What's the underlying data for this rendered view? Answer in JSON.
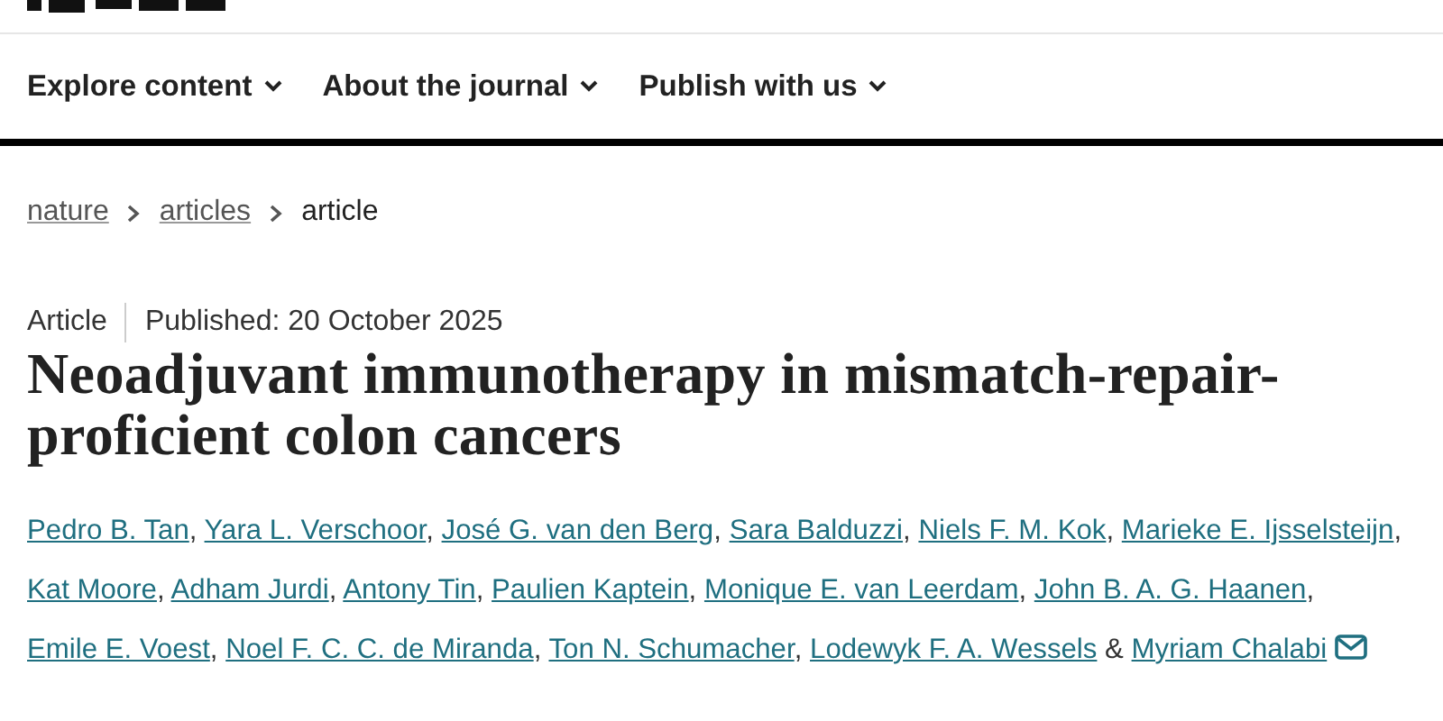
{
  "nav": [
    {
      "label": "Explore content"
    },
    {
      "label": "About the journal"
    },
    {
      "label": "Publish with us"
    }
  ],
  "breadcrumb": [
    {
      "label": "nature",
      "link": true
    },
    {
      "label": "articles",
      "link": true
    },
    {
      "label": "article",
      "link": false
    }
  ],
  "article": {
    "type": "Article",
    "published": "Published: 20 October 2025",
    "title": "Neoadjuvant immunotherapy in mismatch-repair-proficient colon cancers",
    "authors": [
      {
        "name": "Pedro B. Tan",
        "separator": ","
      },
      {
        "name": "Yara L. Verschoor",
        "separator": ","
      },
      {
        "name": "José G. van den Berg",
        "separator": ","
      },
      {
        "name": "Sara Balduzzi",
        "separator": ","
      },
      {
        "name": "Niels F. M. Kok",
        "separator": ","
      },
      {
        "name": "Marieke E. Ijsselsteijn",
        "separator": ","
      },
      {
        "name": "Kat Moore",
        "separator": ","
      },
      {
        "name": "Adham Jurdi",
        "separator": ","
      },
      {
        "name": "Antony Tin",
        "separator": ","
      },
      {
        "name": "Paulien Kaptein",
        "separator": ","
      },
      {
        "name": "Monique E. van Leerdam",
        "separator": ","
      },
      {
        "name": "John B. A. G. Haanen",
        "separator": ","
      },
      {
        "name": "Emile E. Voest",
        "separator": ","
      },
      {
        "name": "Noel F. C. C. de Miranda",
        "separator": ","
      },
      {
        "name": "Ton N. Schumacher",
        "separator": ","
      },
      {
        "name": "Lodewyk F. A. Wessels",
        "separator": "&"
      },
      {
        "name": "Myriam Chalabi",
        "corresponding": true
      }
    ]
  }
}
